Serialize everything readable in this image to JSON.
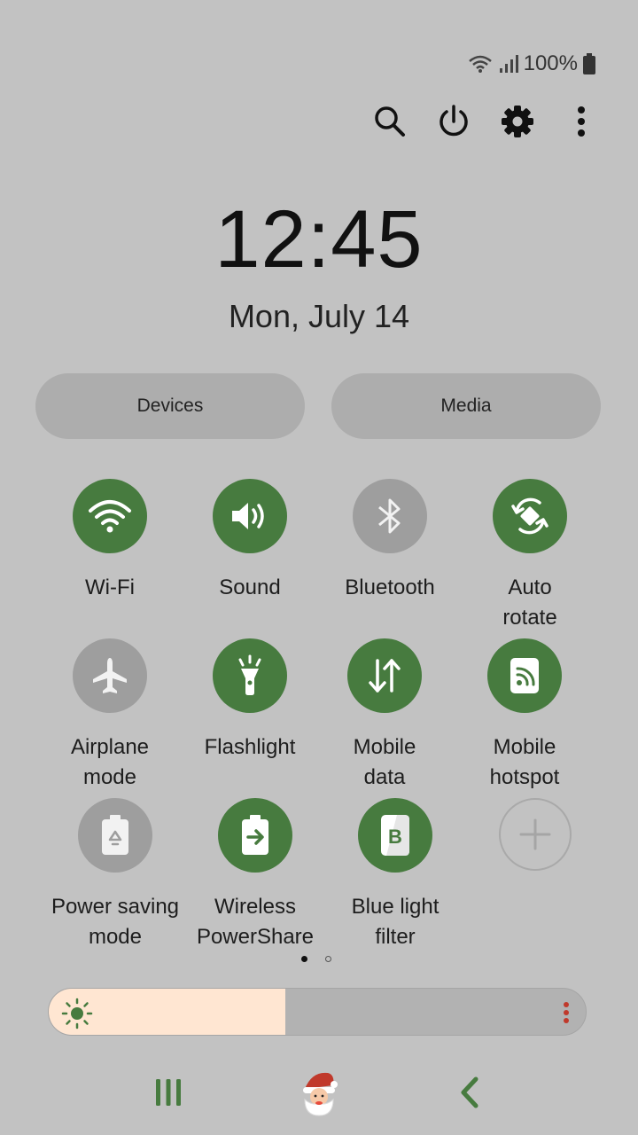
{
  "status": {
    "battery_text": "100%"
  },
  "toolbar": {
    "search_icon": "search-icon",
    "power_icon": "power-icon",
    "settings_icon": "gear-icon",
    "more_icon": "more-vertical-icon"
  },
  "clock": {
    "time": "12:45",
    "date": "Mon, July 14"
  },
  "buttons": {
    "devices": "Devices",
    "media": "Media"
  },
  "tiles": [
    {
      "label": "Wi-Fi",
      "state": "on",
      "icon": "wifi-icon"
    },
    {
      "label": "Sound",
      "state": "on",
      "icon": "sound-icon"
    },
    {
      "label": "Bluetooth",
      "state": "off",
      "icon": "bluetooth-icon"
    },
    {
      "label": "Auto\nrotate",
      "state": "on",
      "icon": "auto-rotate-icon"
    },
    {
      "label": "Airplane\nmode",
      "state": "off",
      "icon": "airplane-icon"
    },
    {
      "label": "Flashlight",
      "state": "on",
      "icon": "flashlight-icon"
    },
    {
      "label": "Mobile\ndata",
      "state": "on",
      "icon": "mobile-data-icon"
    },
    {
      "label": "Mobile\nhotspot",
      "state": "on",
      "icon": "hotspot-icon"
    },
    {
      "label": "Power saving\nmode",
      "state": "off",
      "icon": "power-saving-icon"
    },
    {
      "label": "Wireless\nPowerShare",
      "state": "on",
      "icon": "powershare-icon"
    },
    {
      "label": "Blue light\nfilter",
      "state": "on",
      "icon": "blue-light-icon"
    },
    {
      "label": "",
      "state": "add",
      "icon": "add-icon"
    }
  ],
  "pager": {
    "current": 1,
    "total": 2
  },
  "brightness": {
    "level": 0.44
  },
  "colors": {
    "accent": "#477b3f",
    "off": "#9e9e9e",
    "background": "#c2c2c2",
    "brightness_fill": "#ffe6d2"
  },
  "nav": {
    "recents_icon": "recents-icon",
    "home_icon": "santa-home-icon",
    "back_icon": "back-icon"
  }
}
